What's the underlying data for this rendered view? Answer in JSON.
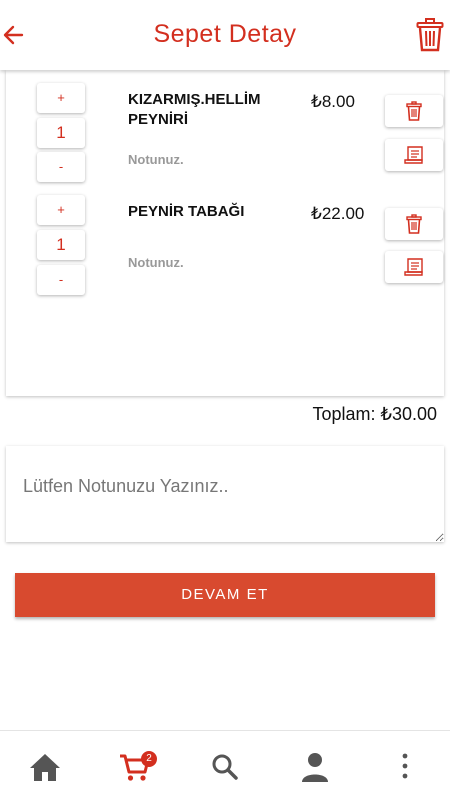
{
  "header": {
    "title": "Sepet Detay",
    "back_icon": "arrow-left-icon",
    "clear_icon": "trash-icon",
    "accent_color": "#d32f1f"
  },
  "cart": {
    "items": [
      {
        "name": "KIZARMIŞ.HELLİM PEYNİRİ",
        "price": "₺8.00",
        "quantity": "1",
        "note_label": "Notunuz.",
        "plus_label": "+",
        "minus_label": "-"
      },
      {
        "name": "PEYNİR TABAĞI",
        "price": "₺22.00",
        "quantity": "1",
        "note_label": "Notunuz.",
        "plus_label": "+",
        "minus_label": "-"
      }
    ],
    "total": "Toplam: ₺30.00"
  },
  "note": {
    "placeholder": "Lütfen Notunuzu Yazınız.."
  },
  "continue_button": {
    "label": "DEVAM ET",
    "color": "#d84a2f"
  },
  "bottom_nav": {
    "items": [
      {
        "icon": "home-icon"
      },
      {
        "icon": "cart-icon",
        "badge": "2"
      },
      {
        "icon": "search-icon"
      },
      {
        "icon": "user-icon"
      },
      {
        "icon": "more-vertical-icon"
      }
    ]
  }
}
